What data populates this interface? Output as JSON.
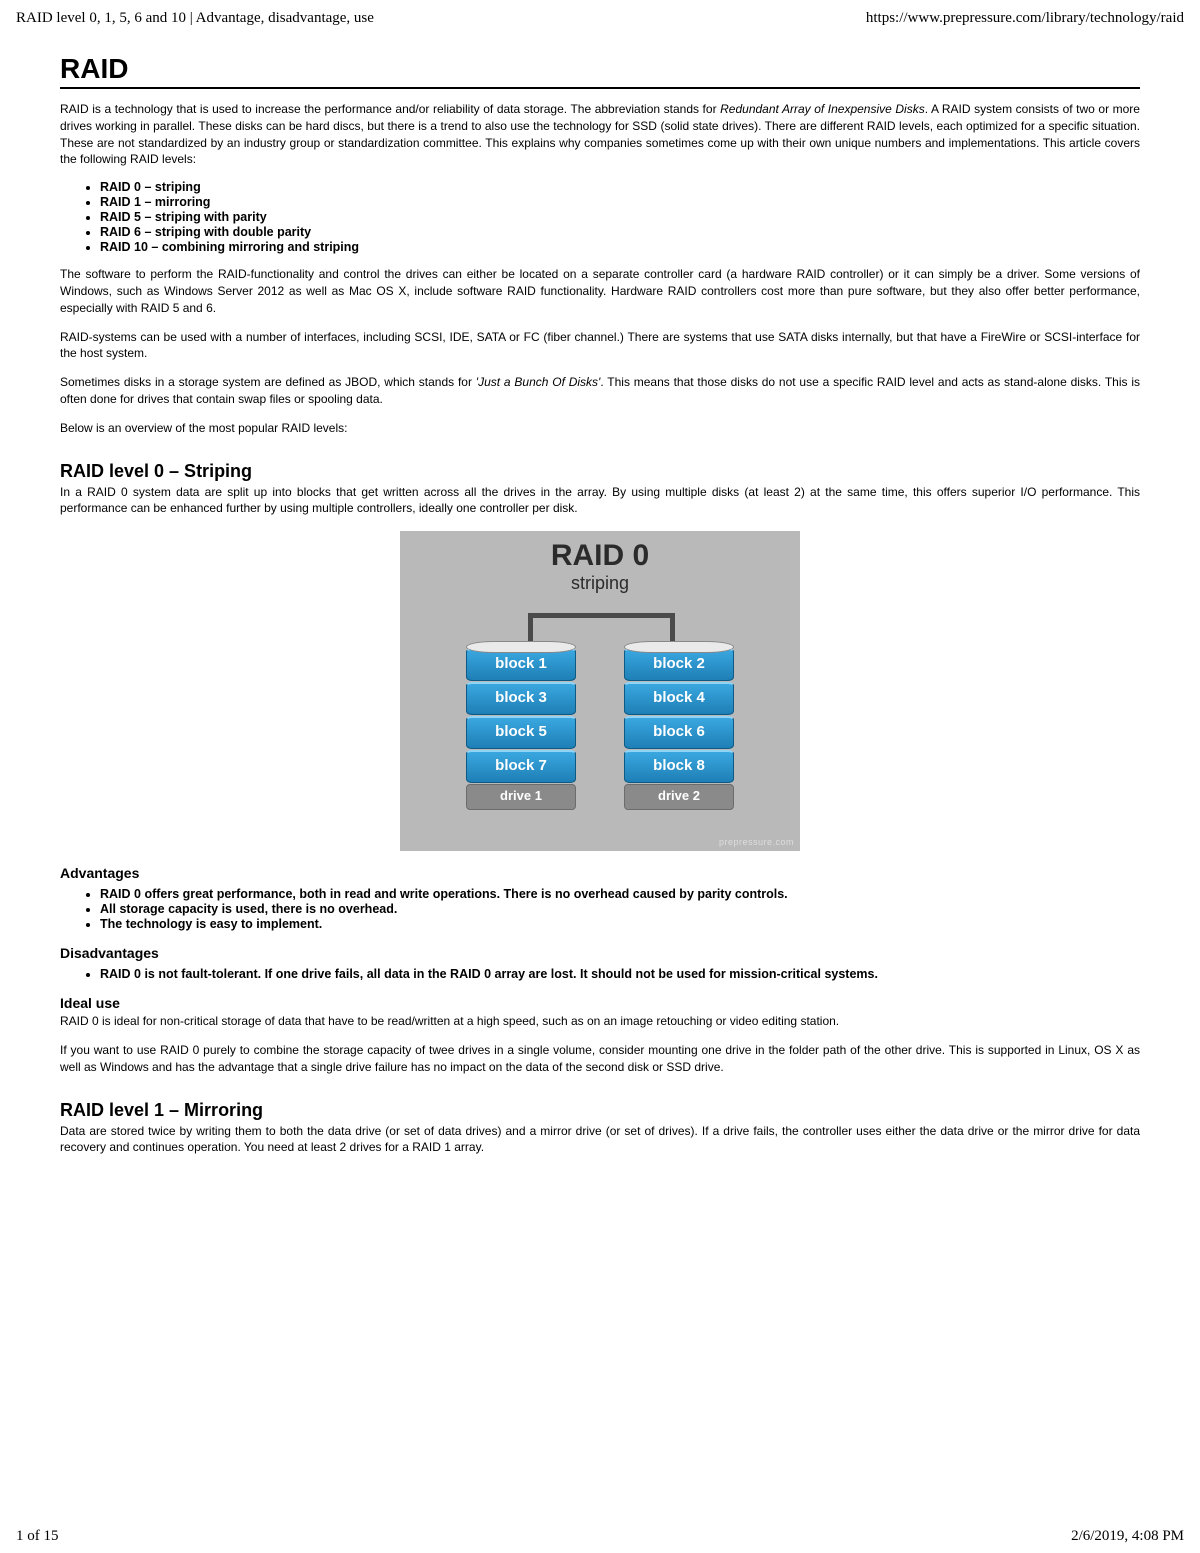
{
  "header": {
    "page_title": "RAID level 0, 1, 5, 6 and 10 | Advantage, disadvantage, use",
    "url": "https://www.prepressure.com/library/technology/raid"
  },
  "title": "RAID",
  "intro": {
    "p1_a": "RAID is a technology that is used to increase the performance and/or reliability of data storage. The abbreviation stands for ",
    "p1_i": "Redundant Array of Inexpensive Disks",
    "p1_b": ". A RAID system consists of two or more drives working in parallel. These disks can be hard discs, but there is a trend to also use the technology for SSD (solid state drives). There are different RAID levels, each optimized for a specific situation. These are not standardized by an industry group or standardization committee. This explains why companies sometimes come up with their own unique numbers and implementations. This article covers the following RAID levels:"
  },
  "levels": [
    "RAID 0 – striping",
    "RAID 1 – mirroring",
    "RAID 5 – striping with parity",
    "RAID 6 – striping with double parity",
    "RAID 10 – combining mirroring and striping"
  ],
  "p2": "The software to perform the RAID-functionality and control the drives can either be located on a separate controller card (a hardware RAID controller) or it can simply be a driver. Some versions of Windows, such as Windows Server 2012 as well as Mac OS X, include software RAID functionality. Hardware RAID controllers cost more than pure software, but they also offer better performance, especially with RAID 5 and 6.",
  "p3": "RAID-systems can be used with a number of interfaces, including SCSI, IDE, SATA or FC (fiber channel.) There are systems that use SATA disks internally, but that have a FireWire or SCSI-interface for the host system.",
  "p4_a": "Sometimes disks in a storage system are defined as JBOD, which stands for ",
  "p4_i": "'Just a Bunch Of Disks'",
  "p4_b": ". This means that those disks do not use a specific RAID level and acts as stand-alone disks. This is often done for drives that contain swap files or spooling data.",
  "p5": "Below is an overview of the most popular RAID levels:",
  "raid0": {
    "heading": "RAID level 0 – Striping",
    "desc": "In a RAID 0 system data are split up into blocks that get written across all the drives in the array. By using multiple disks (at least 2) at the same time, this offers superior I/O performance. This performance can be enhanced further by using multiple controllers, ideally one controller per disk.",
    "diagram": {
      "title": "RAID 0",
      "subtitle": "striping",
      "watermark": "prepressure.com",
      "drive1": {
        "label": "drive 1",
        "blocks": [
          "block 1",
          "block 3",
          "block 5",
          "block 7"
        ]
      },
      "drive2": {
        "label": "drive 2",
        "blocks": [
          "block 2",
          "block 4",
          "block 6",
          "block 8"
        ]
      }
    },
    "adv_h": "Advantages",
    "advantages": [
      "RAID 0 offers great performance, both in read and write operations. There is no overhead caused by parity controls.",
      "All storage capacity is used, there is no overhead.",
      "The technology is easy to implement."
    ],
    "dis_h": "Disadvantages",
    "disadvantages": [
      "RAID 0 is not fault-tolerant. If one drive fails, all data in the RAID 0 array are lost. It should not be used for mission-critical systems."
    ],
    "ideal_h": "Ideal use",
    "ideal_p1": "RAID 0 is ideal for non-critical storage of data that have to be read/written at a high speed, such as on an image retouching or video editing station.",
    "ideal_p2": "If you want to use RAID 0 purely to combine the storage capacity of twee drives in a single volume, consider mounting one drive in the folder path of the other drive. This is supported in Linux, OS X as well as Windows and has the advantage that a single drive failure has no impact on the data of the second disk or SSD drive."
  },
  "raid1": {
    "heading": "RAID level 1 – Mirroring",
    "desc": "Data are stored twice by writing them to both the data drive (or set of data drives) and a mirror drive (or set of drives). If a drive fails, the controller uses either the data drive or the mirror drive for data recovery and continues operation. You need at least 2 drives for a RAID 1 array."
  },
  "footer": {
    "page": "1 of 15",
    "datetime": "2/6/2019, 4:08 PM"
  }
}
